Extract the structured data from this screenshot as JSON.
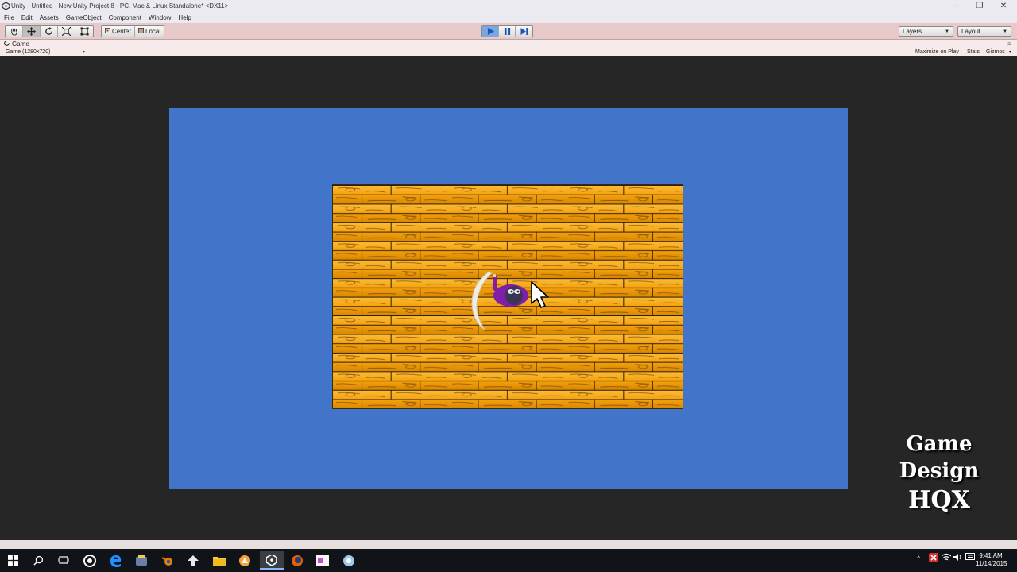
{
  "window": {
    "title": "Unity - Untitled - New Unity Project 8 - PC, Mac & Linux Standalone* <DX11>",
    "controls": [
      "minimize",
      "restore",
      "close"
    ]
  },
  "menu": [
    "File",
    "Edit",
    "Assets",
    "GameObject",
    "Component",
    "Window",
    "Help"
  ],
  "toolbar": {
    "transform_tools": [
      "hand-icon",
      "move-icon",
      "rotate-icon",
      "scale-icon",
      "rect-icon"
    ],
    "active_tool": "move-icon",
    "pivot_label": "Center",
    "space_label": "Local",
    "play_state": "playing",
    "layers_label": "Layers",
    "layout_label": "Layout"
  },
  "game_view": {
    "tab_label": "Game",
    "resolution_label": "Game (1280x720)",
    "maximize_label": "Maximize on Play",
    "stats_label": "Stats",
    "gizmos_label": "Gizmos",
    "colors": {
      "camera_background": "#4275c9",
      "viewport_background": "#262626",
      "plank": "#f5a30f",
      "plank_grain": "#7a4a0a",
      "character": "#7f1fa8"
    }
  },
  "watermark": {
    "line1": "Game",
    "line2": "Design",
    "line3": "HQX"
  },
  "taskbar": {
    "time": "9:41 AM",
    "date": "11/14/2015"
  }
}
